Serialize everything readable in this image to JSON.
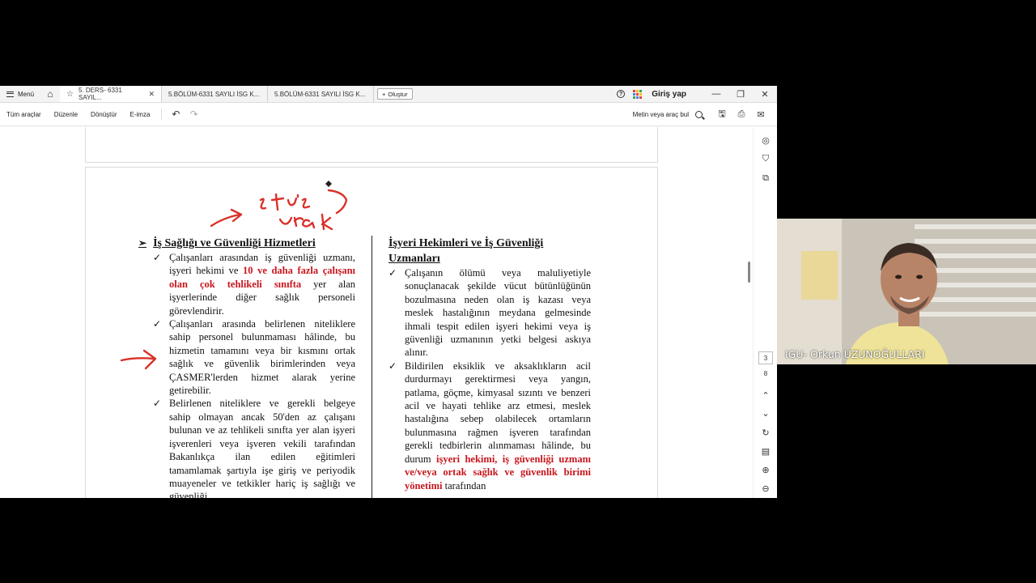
{
  "tabbar": {
    "menu_label": "Menü",
    "tabs": [
      {
        "label": "5. DERS- 6331 SAYIL..."
      },
      {
        "label": "5.BÖLÜM-6331 SAYILI İSG K..."
      },
      {
        "label": "5.BÖLÜM-6331 SAYILI İSG K..."
      }
    ],
    "new_label": "Oluştur",
    "login_label": "Giriş yap"
  },
  "toolbar": {
    "all_tools": "Tüm araçlar",
    "edit": "Düzenle",
    "convert": "Dönüştür",
    "esign": "E-imza",
    "search_label": "Metin veya araç bul"
  },
  "document": {
    "left": {
      "heading": "İş Sağlığı ve Güvenliği Hizmetleri",
      "bullets": [
        {
          "pre": "Çalışanları arasından iş güvenliği uzmanı, işyeri hekimi ve ",
          "red": "10 ve daha fazla çalışanı olan çok tehlikeli sınıfta",
          "post": " yer alan işyerlerinde diğer sağlık personeli görevlendirir."
        },
        {
          "text": "Çalışanları arasında belirlenen niteliklere sahip personel bulunmaması hâlinde, bu hizmetin tamamını veya bir kısmını ortak sağlık ve güvenlik birimlerinden veya ÇASMER'lerden hizmet alarak yerine getirebilir."
        },
        {
          "text": "Belirlenen niteliklere ve gerekli belgeye sahip olmayan ancak 50'den az çalışanı bulunan ve az tehlikeli sınıfta yer alan işyeri işverenleri veya işveren vekili tarafından Bakanlıkça ilan edilen eğitimleri tamamlamak şartıyla işe giriş ve periyodik muayeneler ve tetkikler hariç iş sağlığı ve güvenliği"
        }
      ]
    },
    "right": {
      "heading": "İşyeri Hekimleri ve İş Güvenliği Uzmanları",
      "bullets": [
        {
          "text": "Çalışanın ölümü veya maluliyetiyle sonuçlanacak şekilde vücut bütünlüğünün bozulmasına neden olan iş kazası veya meslek hastalığının meydana gelmesinde ihmali tespit edilen işyeri hekimi veya iş güvenliği uzmanının yetki belgesi askıya alınır."
        },
        {
          "pre": "Bildirilen eksiklik ve aksaklıkların acil durdurmayı gerektirmesi veya yangın, patlama, göçme, kimyasal sızıntı ve benzeri acil ve hayati tehlike arz etmesi, meslek hastalığına sebep olabilecek ortamların bulunmasına rağmen işveren tarafından gerekli tedbirlerin alınmaması hâlinde, bu durum ",
          "red": "işyeri hekimi, iş güvenliği uzmanı ve/veya ortak sağlık ve güvenlik birimi yönetimi",
          "post": " tarafından"
        }
      ]
    }
  },
  "rail": {
    "current_page": "3",
    "total_pages": "8"
  },
  "webcam": {
    "name": "IGU- Orkun UZUNOĞULLARI"
  },
  "colors": {
    "annotation_red": "#d9312a",
    "highlight_red": "#c8161d"
  }
}
